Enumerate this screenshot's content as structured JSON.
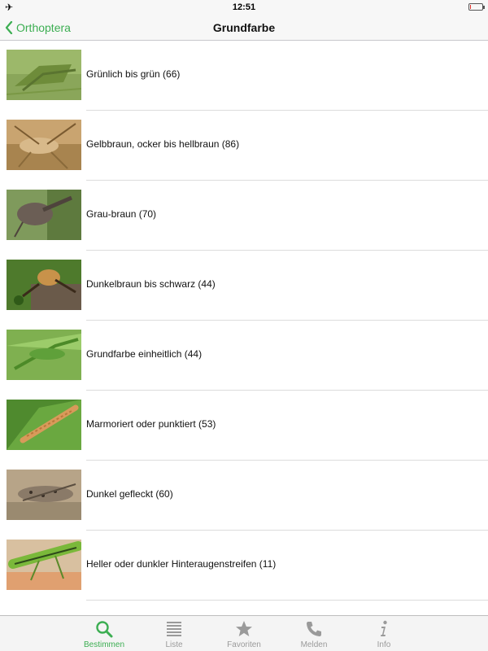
{
  "status_bar": {
    "time": "12:51",
    "battery_level": 0.1
  },
  "nav": {
    "back_label": "Orthoptera",
    "title": "Grundfarbe"
  },
  "colors": {
    "accent": "#3cae52",
    "inactive": "#9a9a9a",
    "battery": "#e0302a"
  },
  "items": [
    {
      "label": "Grünlich bis grün (66)",
      "thumb": "green-grasshopper"
    },
    {
      "label": "Gelbbraun, ocker bis hellbraun (86)",
      "thumb": "tan-cricket"
    },
    {
      "label": "Grau-braun (70)",
      "thumb": "grey-brown-grasshopper"
    },
    {
      "label": "Dunkelbraun bis schwarz (44)",
      "thumb": "dark-brown-cricket"
    },
    {
      "label": "Grundfarbe einheitlich (44)",
      "thumb": "uniform-green-bushcricket"
    },
    {
      "label": "Marmoriert oder punktiert (53)",
      "thumb": "marbled-grasshopper"
    },
    {
      "label": "Dunkel gefleckt (60)",
      "thumb": "spotted-grasshopper"
    },
    {
      "label": "Heller oder dunkler Hinteraugenstreifen (11)",
      "thumb": "striped-grasshopper"
    }
  ],
  "tabs": [
    {
      "label": "Bestimmen",
      "icon": "search-icon",
      "active": true
    },
    {
      "label": "Liste",
      "icon": "list-icon",
      "active": false
    },
    {
      "label": "Favoriten",
      "icon": "star-icon",
      "active": false
    },
    {
      "label": "Melden",
      "icon": "phone-icon",
      "active": false
    },
    {
      "label": "Info",
      "icon": "info-icon",
      "active": false
    }
  ]
}
